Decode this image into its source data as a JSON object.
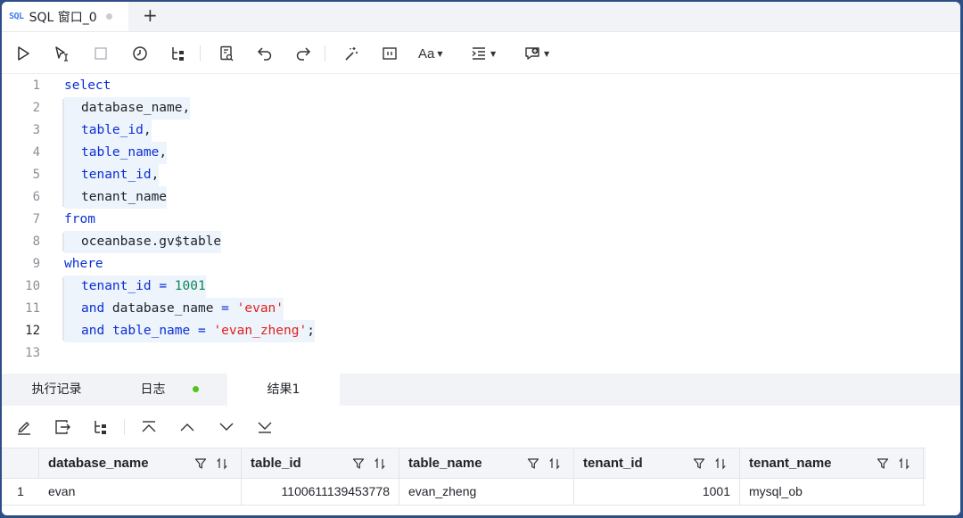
{
  "tab": {
    "badge": "SQL",
    "title": "SQL 窗口_0",
    "add": "+"
  },
  "toolbar": {
    "font_label": "Aa"
  },
  "editor": {
    "active_line": 12,
    "lines": [
      {
        "n": "1",
        "tokens": [
          {
            "t": "select",
            "c": "kw"
          }
        ],
        "indent": 0
      },
      {
        "n": "2",
        "tokens": [
          {
            "t": "database_name,",
            "c": ""
          }
        ],
        "indent": 1
      },
      {
        "n": "3",
        "tokens": [
          {
            "t": "table_id",
            "c": "kw"
          },
          {
            "t": ",",
            "c": ""
          }
        ],
        "indent": 1
      },
      {
        "n": "4",
        "tokens": [
          {
            "t": "table_name",
            "c": "kw"
          },
          {
            "t": ",",
            "c": ""
          }
        ],
        "indent": 1
      },
      {
        "n": "5",
        "tokens": [
          {
            "t": "tenant_id",
            "c": "kw"
          },
          {
            "t": ",",
            "c": ""
          }
        ],
        "indent": 1
      },
      {
        "n": "6",
        "tokens": [
          {
            "t": "tenant_name",
            "c": ""
          }
        ],
        "indent": 1
      },
      {
        "n": "7",
        "tokens": [
          {
            "t": "from",
            "c": "kw"
          }
        ],
        "indent": 0
      },
      {
        "n": "8",
        "tokens": [
          {
            "t": "oceanbase.gv$table",
            "c": ""
          }
        ],
        "indent": 1
      },
      {
        "n": "9",
        "tokens": [
          {
            "t": "where",
            "c": "kw"
          }
        ],
        "indent": 0
      },
      {
        "n": "10",
        "tokens": [
          {
            "t": "tenant_id",
            "c": "kw"
          },
          {
            "t": " ",
            "c": ""
          },
          {
            "t": "=",
            "c": "kw"
          },
          {
            "t": " ",
            "c": ""
          },
          {
            "t": "1001",
            "c": "num"
          }
        ],
        "indent": 1
      },
      {
        "n": "11",
        "tokens": [
          {
            "t": "and",
            "c": "kw"
          },
          {
            "t": " database_name ",
            "c": ""
          },
          {
            "t": "=",
            "c": "kw"
          },
          {
            "t": " ",
            "c": ""
          },
          {
            "t": "'evan'",
            "c": "str"
          }
        ],
        "indent": 1
      },
      {
        "n": "12",
        "tokens": [
          {
            "t": "and",
            "c": "kw"
          },
          {
            "t": " ",
            "c": ""
          },
          {
            "t": "table_name",
            "c": "kw"
          },
          {
            "t": " ",
            "c": ""
          },
          {
            "t": "=",
            "c": "kw"
          },
          {
            "t": " ",
            "c": ""
          },
          {
            "t": "'evan_zheng'",
            "c": "str"
          },
          {
            "t": ";",
            "c": ""
          }
        ],
        "indent": 1
      },
      {
        "n": "13",
        "tokens": [],
        "indent": 0
      }
    ]
  },
  "bottom_tabs": [
    {
      "label": "执行记录"
    },
    {
      "label": "日志"
    },
    {
      "label": "结果1"
    }
  ],
  "colors": {
    "keyword": "#0a2fd6",
    "number": "#098658",
    "string": "#e0201b",
    "status_ok": "#52c41a"
  },
  "grid": {
    "columns": [
      "database_name",
      "table_id",
      "table_name",
      "tenant_id",
      "tenant_name"
    ],
    "rows": [
      {
        "num": "1",
        "cells": [
          "evan",
          "1100611139453778",
          "evan_zheng",
          "1001",
          "mysql_ob"
        ]
      }
    ]
  }
}
